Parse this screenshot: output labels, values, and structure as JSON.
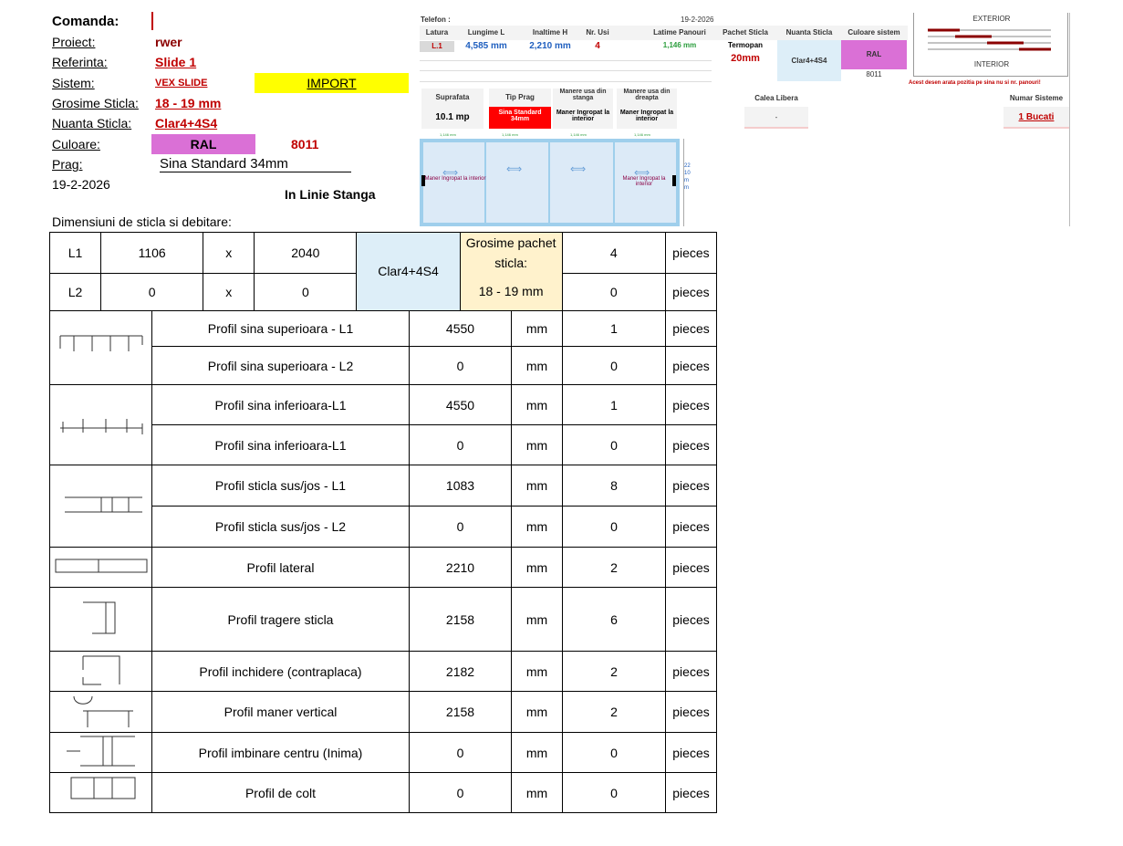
{
  "header": {
    "comanda_label": "Comanda:",
    "proiect_label": "Proiect:",
    "proiect_value": "rwer",
    "referinta_label": "Referinta:",
    "referinta_value": "Slide 1",
    "sistem_label": "Sistem:",
    "sistem_value": "VEX SLIDE",
    "import_label": "IMPORT",
    "grosime_label": "Grosime Sticla:",
    "grosime_value": "18 - 19 mm",
    "nuanta_label": "Nuanta Sticla:",
    "nuanta_value": "Clar4+4S4",
    "culoare_label": "Culoare:",
    "culoare_value": "RAL",
    "culoare_code": "8011",
    "prag_label": "Prag:",
    "prag_value": "Sina Standard 34mm",
    "date": "19-2-2026",
    "direction": "In Linie Stanga",
    "dimensions_title": "Dimensiuni de sticla si debitare:"
  },
  "summary": {
    "telefon_label": "Telefon :",
    "date": "19-2-2026",
    "columns": [
      "Latura",
      "Lungime L",
      "Inaltime H",
      "Nr. Usi",
      "",
      "Latime Panouri",
      "Pachet Sticla",
      "Nuanta Sticla",
      "Culoare sistem"
    ],
    "row": {
      "latura": "L.1",
      "lungime": "4,585 mm",
      "inaltime": "2,210 mm",
      "nr_usi": "4",
      "latime": "1,146 mm",
      "pachet_top": "Termopan",
      "pachet_bottom": "20mm",
      "nuanta": "Clar4+4S4",
      "culoare": "RAL",
      "culoare_code": "8011"
    },
    "columns2": [
      "Suprafata",
      "Tip Prag",
      "Manere usa din stanga",
      "Manere usa din dreapta"
    ],
    "row2": {
      "suprafata": "10.1 mp",
      "tip_prag": "Sina Standard 34mm",
      "manere_stanga": "Maner Ingropat la interior",
      "manere_dreapta": "Maner Ingropat la interior"
    },
    "calea_label": "Calea Libera",
    "calea_value": "-",
    "numar_label": "Numar Sisteme",
    "numar_value": "1 Bucati",
    "exterior": "EXTERIOR",
    "interior": "INTERIOR",
    "warning": "Acest desen arata pozitia pe sina nu si nr. panouri!",
    "panel_widths": [
      "1,146 mm",
      "1,146 mm",
      "1,146 mm",
      "1,146 mm"
    ],
    "panel_handle_left": "Maner Ingropat la interior",
    "panel_handle_right": "Maner Ingropat la interior",
    "height_label": "2210 mm"
  },
  "glass_rows": [
    {
      "label": "L1",
      "w": "1106",
      "x": "x",
      "h": "2040",
      "qty": "4",
      "unit": "pieces"
    },
    {
      "label": "L2",
      "w": "0",
      "x": "x",
      "h": "0",
      "qty": "0",
      "unit": "pieces"
    }
  ],
  "glass_shade": "Clar4+4S4",
  "glass_pack_label": "Grosime pachet sticla:",
  "glass_pack_value": "18 - 19 mm",
  "profiles": [
    {
      "name": "Profil sina superioara  - L1",
      "len": "4550",
      "unit": "mm",
      "qty": "1",
      "pcs": "pieces"
    },
    {
      "name": "Profil sina superioara  - L2",
      "len": "0",
      "unit": "mm",
      "qty": "0",
      "pcs": "pieces"
    },
    {
      "name": "Profil sina inferioara-L1",
      "len": "4550",
      "unit": "mm",
      "qty": "1",
      "pcs": "pieces"
    },
    {
      "name": "Profil sina inferioara-L1",
      "len": "0",
      "unit": "mm",
      "qty": "0",
      "pcs": "pieces"
    },
    {
      "name": "Profil sticla sus/jos  - L1",
      "len": "1083",
      "unit": "mm",
      "qty": "8",
      "pcs": "pieces"
    },
    {
      "name": "Profil sticla sus/jos  - L2",
      "len": "0",
      "unit": "mm",
      "qty": "0",
      "pcs": "pieces"
    },
    {
      "name": "Profil lateral",
      "len": "2210",
      "unit": "mm",
      "qty": "2",
      "pcs": "pieces"
    },
    {
      "name": "Profil tragere sticla",
      "len": "2158",
      "unit": "mm",
      "qty": "6",
      "pcs": "pieces"
    },
    {
      "name": "Profil inchidere (contraplaca)",
      "len": "2182",
      "unit": "mm",
      "qty": "2",
      "pcs": "pieces"
    },
    {
      "name": "Profil maner vertical",
      "len": "2158",
      "unit": "mm",
      "qty": "2",
      "pcs": "pieces"
    },
    {
      "name": "Profil imbinare centru (Inima)",
      "len": "0",
      "unit": "mm",
      "qty": "0",
      "pcs": "pieces"
    },
    {
      "name": "Profil de colt",
      "len": "0",
      "unit": "mm",
      "qty": "0",
      "pcs": "pieces"
    }
  ],
  "colors": {
    "accent_red": "#c00000",
    "yellow": "#ffff00",
    "magenta": "#da70d6",
    "glass_blue": "#ddeef8",
    "pale_yellow": "#fff2cc"
  }
}
